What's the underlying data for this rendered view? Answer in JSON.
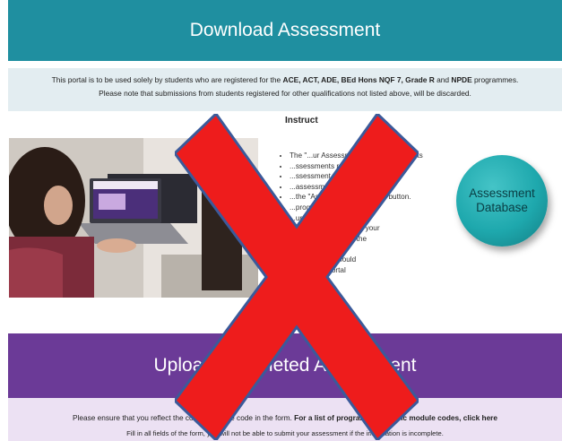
{
  "header": {
    "title": "Download Assessment"
  },
  "notice": {
    "l1_pre": "This  portal is to be used solely by students who are registered for the ",
    "l1_bold1": "ACE, ACT, ADE, BEd Hons NQF 7, Grade R",
    "l1_mid": " and ",
    "l1_bold2": "NPDE",
    "l1_post": " programmes.",
    "l2": "Please note that submissions from students registered for other qualifications not listed above, will be discarded."
  },
  "instructions": {
    "title": "Instruct",
    "steps": [
      "The \"...ur Assessment Database\" reflects",
      "...ssessments relating to the Final",
      "...ssessment ONLY.",
      "...assessment by clicking on",
      "...the \"Assessment Database\" button.",
      "...programme Folder and",
      "...ur module code.",
      "...the file and complete your",
      "...assessment using the",
      "...ow.",
      "...ue 09 May) should",
      "...using the portal"
    ]
  },
  "assessment_button": {
    "line1": "Assessment",
    "line2": "Database"
  },
  "upload_banner": {
    "title": "Upload Completed Assessment",
    "visible_left": "Uplo",
    "visible_mid": "mpleted",
    "visible_right": "nent"
  },
  "lower_notice": {
    "l1_pre": "Please ensure that you reflect the correct module code in the form.  ",
    "l1_bold": "For a list of programme specific module codes, click here",
    "l2": "Fill in all fields of the form, you will not be able to submit your assessment if the information is incomplete."
  },
  "icons": {
    "overlay": "red-x-icon",
    "photo": "student-laptop-photo"
  },
  "colors": {
    "header": "#1f8fa0",
    "purple": "#6b3a97",
    "overlay": "#ee1c1c"
  }
}
